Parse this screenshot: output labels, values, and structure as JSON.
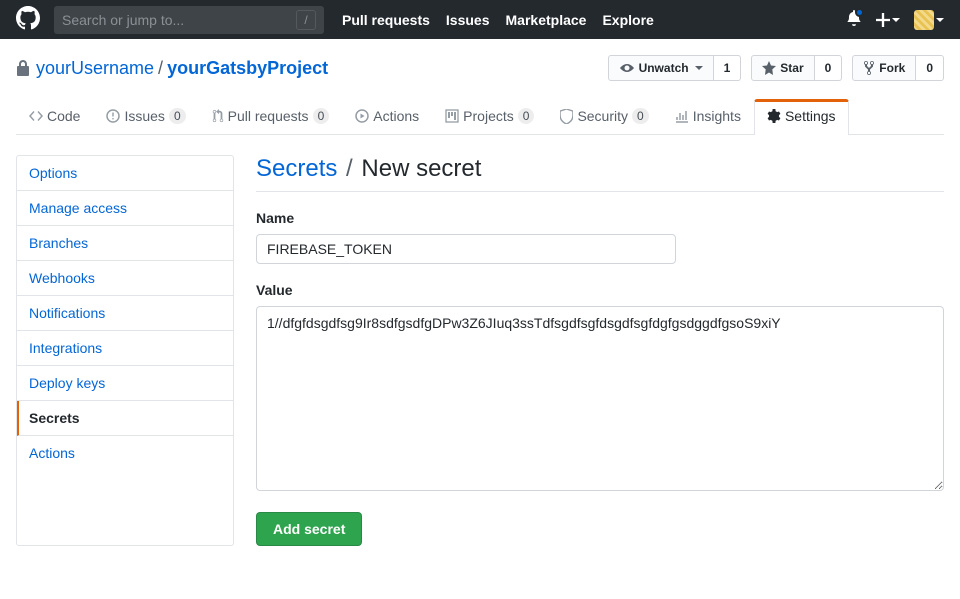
{
  "header": {
    "search_placeholder": "Search or jump to...",
    "nav": [
      "Pull requests",
      "Issues",
      "Marketplace",
      "Explore"
    ]
  },
  "repo": {
    "owner": "yourUsername",
    "name": "yourGatsbyProject",
    "watch_label": "Unwatch",
    "watch_count": "1",
    "star_label": "Star",
    "star_count": "0",
    "fork_label": "Fork",
    "fork_count": "0"
  },
  "tabs": {
    "code": "Code",
    "issues": "Issues",
    "issues_count": "0",
    "pulls": "Pull requests",
    "pulls_count": "0",
    "actions": "Actions",
    "projects": "Projects",
    "projects_count": "0",
    "security": "Security",
    "security_count": "0",
    "insights": "Insights",
    "settings": "Settings"
  },
  "sidenav": {
    "options": "Options",
    "manage_access": "Manage access",
    "branches": "Branches",
    "webhooks": "Webhooks",
    "notifications": "Notifications",
    "integrations": "Integrations",
    "deploy_keys": "Deploy keys",
    "secrets": "Secrets",
    "actions": "Actions"
  },
  "page": {
    "breadcrumb_root": "Secrets",
    "breadcrumb_sep": "/",
    "breadcrumb_current": "New secret",
    "name_label": "Name",
    "name_value": "FIREBASE_TOKEN",
    "value_label": "Value",
    "value_value": "1//dfgfdsgdfsg9Ir8sdfgsdfgDPw3Z6JIuq3ssTdfsgdfsgfdsgdfsgfdgfgsdggdfgsoS9xiY",
    "submit_label": "Add secret"
  }
}
